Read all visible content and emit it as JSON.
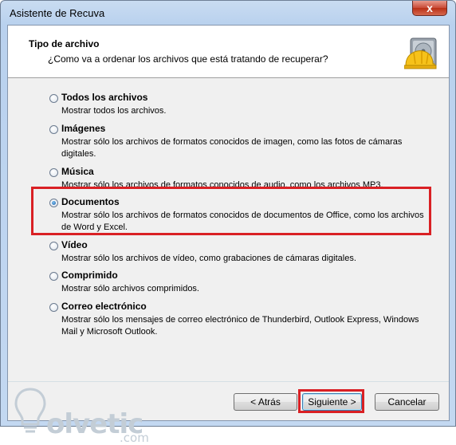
{
  "window": {
    "title": "Asistente de Recuva",
    "close_glyph": "x"
  },
  "header": {
    "title": "Tipo de archivo",
    "subtitle": "¿Como va a ordenar los archivos que está tratando de recuperar?",
    "logo_icon": "hard-drive-helmet-icon"
  },
  "options": [
    {
      "label": "Todos los archivos",
      "desc": "Mostrar todos los archivos.",
      "checked": false
    },
    {
      "label": "Imágenes",
      "desc": "Mostrar sólo los archivos de formatos conocidos de imagen, como las fotos de cámaras digitales.",
      "checked": false
    },
    {
      "label": "Música",
      "desc": "Mostrar sólo los archivos de formatos conocidos de audio, como los archivos MP3.",
      "checked": false
    },
    {
      "label": "Documentos",
      "desc": "Mostrar sólo los archivos de formatos conocidos de documentos de Office, como los archivos de Word y Excel.",
      "checked": true
    },
    {
      "label": "Vídeo",
      "desc": "Mostrar sólo los archivos de vídeo, como grabaciones de cámaras digitales.",
      "checked": false
    },
    {
      "label": "Comprimido",
      "desc": "Mostrar sólo archivos comprimidos.",
      "checked": false
    },
    {
      "label": "Correo electrónico",
      "desc": "Mostrar sólo los mensajes de correo electrónico de Thunderbird, Outlook Express, Windows Mail y Microsoft Outlook.",
      "checked": false
    }
  ],
  "buttons": {
    "back": "< Atrás",
    "next": "Siguiente >",
    "cancel": "Cancelar"
  },
  "watermark": {
    "text": "olvetic",
    "domain": ".com"
  },
  "colors": {
    "highlight": "#d92024",
    "title_bar": "#b9d1ee",
    "close_button": "#c84a36"
  }
}
